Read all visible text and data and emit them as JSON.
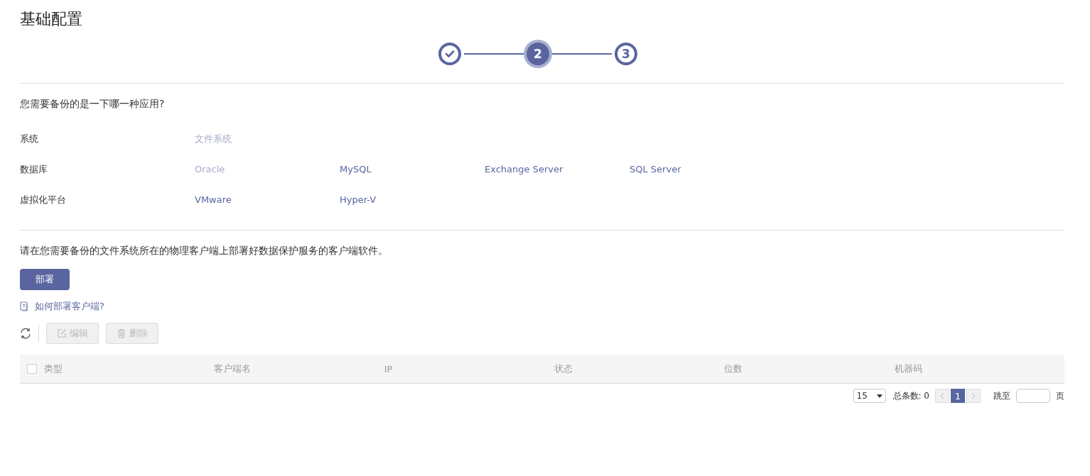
{
  "title": "基础配置",
  "steps": [
    {
      "completed": true,
      "selected": false
    },
    {
      "completed": false,
      "selected": true,
      "label": "2"
    },
    {
      "completed": false,
      "selected": false,
      "label": "3"
    }
  ],
  "question": "您需要备份的是一下哪一种应用?",
  "categories": [
    {
      "label": "系统",
      "options": [
        {
          "label": "文件系统",
          "disabled": true
        }
      ]
    },
    {
      "label": "数据库",
      "options": [
        {
          "label": "Oracle",
          "disabled": true
        },
        {
          "label": "MySQL",
          "disabled": false
        },
        {
          "label": "Exchange Server",
          "disabled": false
        },
        {
          "label": "SQL Server",
          "disabled": false
        }
      ]
    },
    {
      "label": "虚拟化平台",
      "options": [
        {
          "label": "VMware",
          "disabled": false
        },
        {
          "label": "Hyper-V",
          "disabled": false
        }
      ]
    }
  ],
  "instruction": "请在您需要备份的文件系统所在的物理客户端上部署好数据保护服务的客户端软件。",
  "deploy_button": "部署",
  "help_link": "如何部署客户端?",
  "toolbar": [
    {
      "label": "编辑",
      "kind": "edit",
      "disabled": true
    },
    {
      "label": "删除",
      "kind": "delete",
      "disabled": true
    }
  ],
  "table": {
    "select_all_checked": false,
    "columns": [
      "类型",
      "客户端名",
      "IP",
      "状态",
      "位数",
      "机器码"
    ]
  },
  "pagination": {
    "page_size": "15",
    "total_label": "总条数: 0",
    "pages": [
      {
        "label": "1",
        "selected": true
      }
    ],
    "jump_label": "跳至",
    "page_suffix": "页"
  }
}
